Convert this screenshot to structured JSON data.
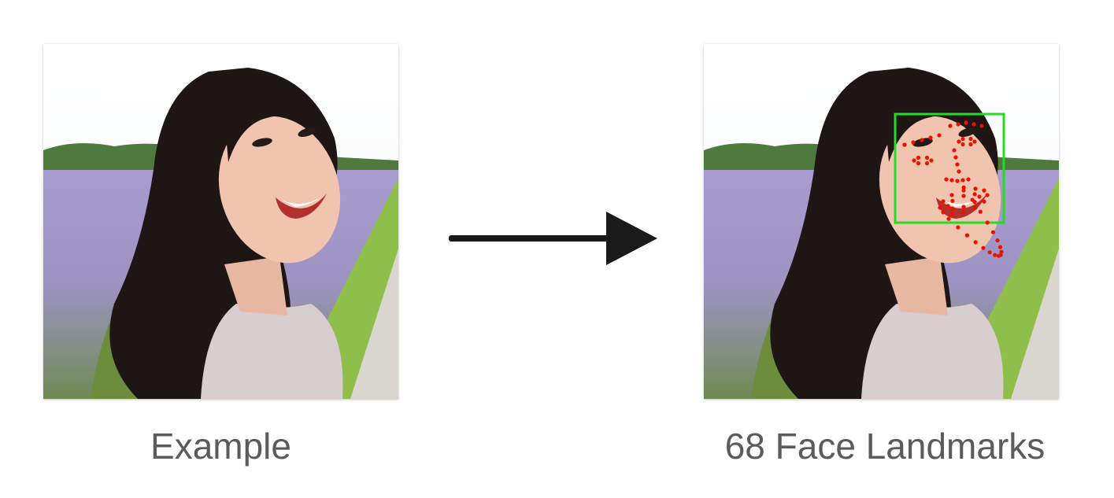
{
  "left": {
    "caption": "Example"
  },
  "right": {
    "caption": "68 Face Landmarks",
    "box_color": "#22dd22",
    "landmark_color": "#ee1100",
    "landmark_count": 68
  },
  "arrow": {
    "icon": "right-arrow-icon",
    "color": "#1a1a1a"
  }
}
